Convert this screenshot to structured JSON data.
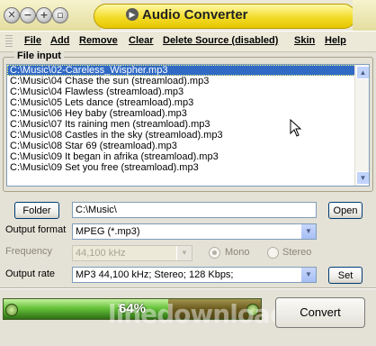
{
  "window": {
    "title": "Audio Converter",
    "title_icon": "play-icon"
  },
  "window_buttons": [
    "✕",
    "−",
    "+",
    "▫"
  ],
  "menu": [
    "File",
    "Add",
    "Remove",
    "Clear",
    "Delete Source (disabled)",
    "Skin",
    "Help"
  ],
  "file_input": {
    "label": "File input",
    "items": [
      "C:\\Music\\02-Careless_Wispher.mp3",
      "C:\\Music\\04 Chase the sun (streamload).mp3",
      "C:\\Music\\04 Flawless (streamload).mp3",
      "C:\\Music\\05 Lets dance (streamload).mp3",
      "C:\\Music\\06 Hey baby (streamload).mp3",
      "C:\\Music\\07 Its raining men (streamload).mp3",
      "C:\\Music\\08 Castles in the sky (streamload).mp3",
      "C:\\Music\\08 Star 69 (streamload).mp3",
      "C:\\Music\\09 It began in afrika (streamload).mp3",
      "C:\\Music\\09 Set you free (streamload).mp3"
    ],
    "selected_index": 0
  },
  "folder": {
    "button_label": "Folder",
    "path": "C:\\Music\\",
    "open_label": "Open"
  },
  "output_format": {
    "label": "Output format",
    "value": "MPEG (*.mp3)"
  },
  "frequency": {
    "label": "Frequency",
    "value": "44,100 kHz",
    "mono_label": "Mono",
    "stereo_label": "Stereo"
  },
  "output_rate": {
    "label": "Output rate",
    "value": "MP3 44,100 kHz; Stereo;  128 Kbps;",
    "set_label": "Set"
  },
  "progress": {
    "value": 0.64,
    "text": "64%"
  },
  "convert_label": "Convert",
  "watermark": "linedownload.com",
  "colors": {
    "title_pill": "#f2dc29",
    "selection": "#316ac5",
    "progress_fill": "#67c33b"
  }
}
